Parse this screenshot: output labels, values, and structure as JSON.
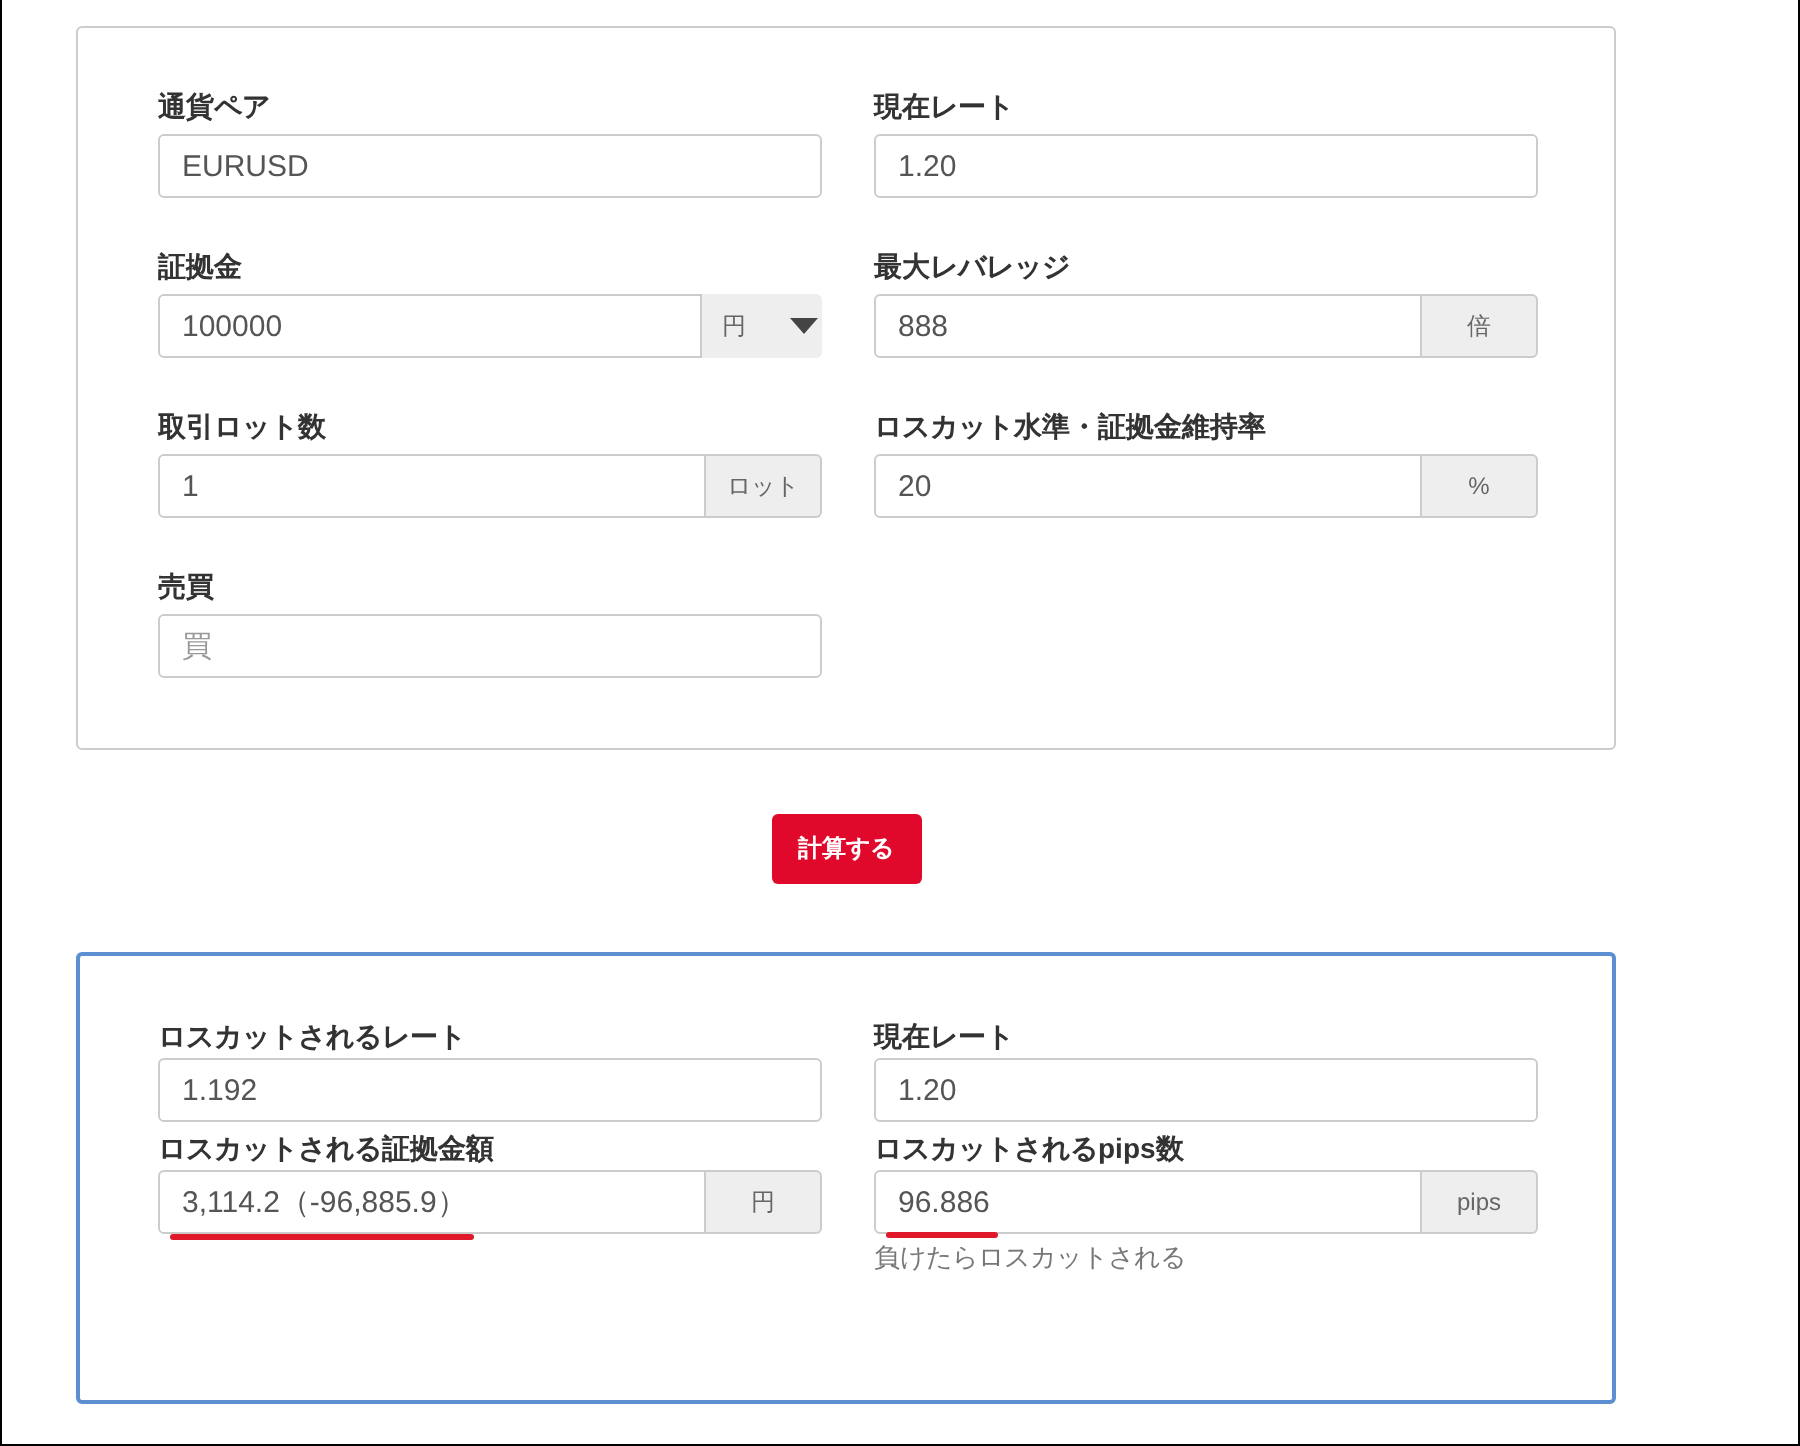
{
  "input_form": {
    "columns": [
      [
        {
          "label": "通貨ペア",
          "value": "EURUSD"
        },
        {
          "label": "証拠金",
          "value": "100000",
          "addon": {
            "kind": "select",
            "text": "円"
          }
        },
        {
          "label": "取引ロット数",
          "value": "1",
          "addon": {
            "kind": "text",
            "text": "ロット"
          }
        },
        {
          "label": "売買",
          "placeholder": "買"
        }
      ],
      [
        {
          "label": "現在レート",
          "value": "1.20"
        },
        {
          "label": "最大レバレッジ",
          "value": "888",
          "addon": {
            "kind": "text",
            "text": "倍"
          }
        },
        {
          "label": "ロスカット水準・証拠金維持率",
          "value": "20",
          "addon": {
            "kind": "text",
            "text": "%"
          }
        }
      ]
    ]
  },
  "calculate_button": "計算する",
  "result": {
    "columns": [
      [
        {
          "label": "ロスカットされるレート",
          "value": "1.192"
        },
        {
          "label": "ロスカットされる証拠金額",
          "value": "3,114.2（-96,885.9）",
          "addon": {
            "kind": "text",
            "text": "円"
          },
          "underlined": true
        }
      ],
      [
        {
          "label": "現在レート",
          "value": "1.20"
        },
        {
          "label": "ロスカットされるpips数",
          "value": "96.886",
          "addon": {
            "kind": "text",
            "text": "pips"
          },
          "underlined": true,
          "note": "負けたらロスカットされる"
        }
      ]
    ]
  }
}
